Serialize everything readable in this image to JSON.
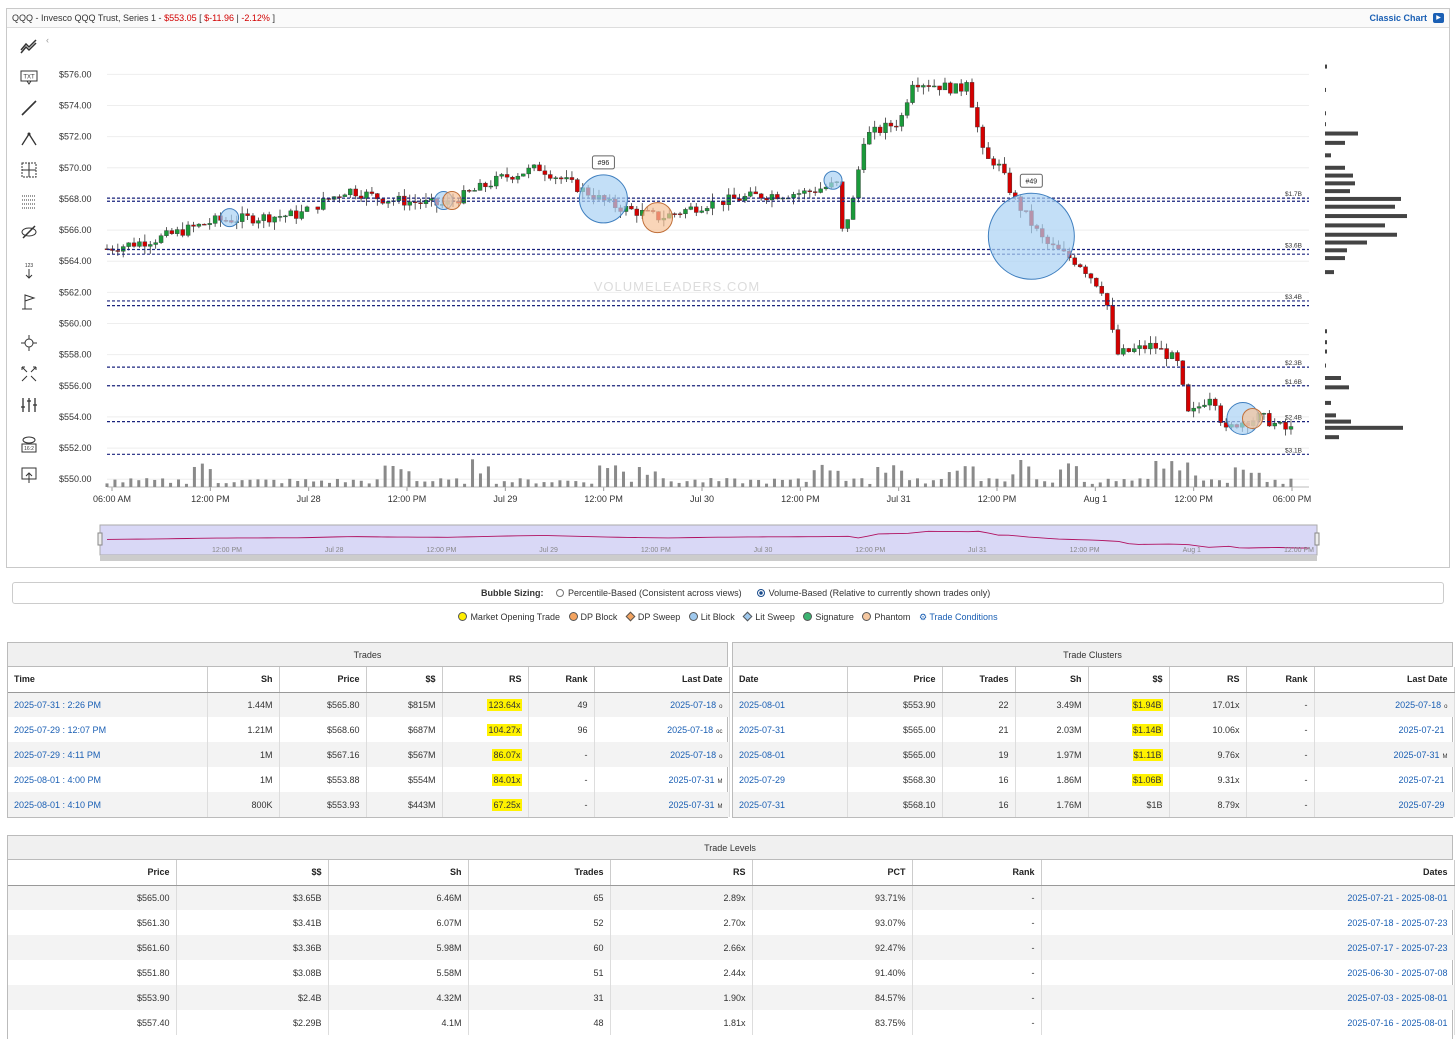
{
  "header": {
    "title": "QQQ - Invesco QQQ Trust, Series 1 -",
    "price": "$553.05",
    "bracket_open": "[",
    "change": "$-11.96",
    "separator": "|",
    "change_pct": "-2.12%",
    "bracket_close": "]",
    "classic_chart": "Classic Chart"
  },
  "toolbar": {
    "tools": [
      "trend-lines-icon",
      "text-icon",
      "line-icon",
      "pattern-icon",
      "crosshair-icon",
      "grid-icon",
      "hide-icon",
      "measure-icon",
      "flag-icon",
      "zoom-icon",
      "fullscreen-icon",
      "adjust-icon",
      "view-icon",
      "export-icon"
    ],
    "txt_label": "TXT",
    "num_label": "123",
    "view_label": "16:2"
  },
  "chart_data": {
    "type": "candlestick",
    "watermark": "VOLUMELEADERS.COM",
    "y_ticks": [
      "$576.00",
      "$574.00",
      "$572.00",
      "$570.00",
      "$568.00",
      "$566.00",
      "$564.00",
      "$562.00",
      "$560.00",
      "$558.00",
      "$556.00",
      "$554.00",
      "$552.00",
      "$550.00"
    ],
    "ylim": [
      549.5,
      577.5
    ],
    "x_ticks": [
      "06:00 AM",
      "12:00 PM",
      "Jul 28",
      "12:00 PM",
      "Jul 29",
      "12:00 PM",
      "Jul 30",
      "12:00 PM",
      "Jul 31",
      "12:00 PM",
      "Aug 1",
      "12:00 PM",
      "06:00 PM"
    ],
    "navigator_ticks": [
      "12:00 PM",
      "Jul 28",
      "12:00 PM",
      "Jul 29",
      "12:00 PM",
      "Jul 30",
      "12:00 PM",
      "Jul 31",
      "12:00 PM",
      "Aug 1",
      "12:00 PM"
    ],
    "levels": [
      {
        "price": 568.05,
        "label": "$1.7B"
      },
      {
        "price": 567.85,
        "label": ""
      },
      {
        "price": 564.75,
        "label": "$3.6B"
      },
      {
        "price": 564.45,
        "label": ""
      },
      {
        "price": 561.45,
        "label": "$3.4B"
      },
      {
        "price": 561.15,
        "label": ""
      },
      {
        "price": 557.2,
        "label": "$2.3B"
      },
      {
        "price": 556.0,
        "label": "$1.6B"
      },
      {
        "price": 553.7,
        "label": "$2.4B"
      },
      {
        "price": 551.6,
        "label": "$3.1B"
      }
    ],
    "bubbles": [
      {
        "t": 0.102,
        "price": 566.8,
        "size": 9,
        "kind": "lit"
      },
      {
        "t": 0.28,
        "price": 567.9,
        "size": 9,
        "kind": "lit"
      },
      {
        "t": 0.287,
        "price": 567.9,
        "size": 9,
        "kind": "phantom"
      },
      {
        "t": 0.413,
        "price": 568.0,
        "size": 24,
        "kind": "lit",
        "tag": "#96"
      },
      {
        "t": 0.458,
        "price": 566.8,
        "size": 15,
        "kind": "phantom"
      },
      {
        "t": 0.604,
        "price": 569.2,
        "size": 9,
        "kind": "lit"
      },
      {
        "t": 0.769,
        "price": 565.6,
        "size": 43,
        "kind": "lit",
        "tag": "#49"
      },
      {
        "t": 0.945,
        "price": 553.9,
        "size": 16,
        "kind": "lit"
      },
      {
        "t": 0.953,
        "price": 553.9,
        "size": 10,
        "kind": "phantom"
      }
    ],
    "profile_bars": [
      {
        "price": 576.5,
        "width": 2
      },
      {
        "price": 575,
        "width": 1
      },
      {
        "price": 573.5,
        "width": 1
      },
      {
        "price": 572.8,
        "width": 1
      },
      {
        "price": 572.2,
        "width": 33
      },
      {
        "price": 571.6,
        "width": 20
      },
      {
        "price": 570.8,
        "width": 6
      },
      {
        "price": 570.0,
        "width": 20
      },
      {
        "price": 569.5,
        "width": 28
      },
      {
        "price": 569.0,
        "width": 30
      },
      {
        "price": 568.5,
        "width": 25
      },
      {
        "price": 568.0,
        "width": 76
      },
      {
        "price": 567.5,
        "width": 70
      },
      {
        "price": 566.9,
        "width": 82
      },
      {
        "price": 566.3,
        "width": 60
      },
      {
        "price": 565.7,
        "width": 72
      },
      {
        "price": 565.2,
        "width": 42
      },
      {
        "price": 564.7,
        "width": 22
      },
      {
        "price": 564.2,
        "width": 20
      },
      {
        "price": 563.3,
        "width": 9
      },
      {
        "price": 559.5,
        "width": 2
      },
      {
        "price": 558.8,
        "width": 2
      },
      {
        "price": 558.2,
        "width": 2
      },
      {
        "price": 557.3,
        "width": 1
      },
      {
        "price": 556.5,
        "width": 16
      },
      {
        "price": 555.9,
        "width": 24
      },
      {
        "price": 554.9,
        "width": 6
      },
      {
        "price": 554.1,
        "width": 11
      },
      {
        "price": 553.7,
        "width": 26
      },
      {
        "price": 553.3,
        "width": 78
      },
      {
        "price": 552.7,
        "width": 14
      }
    ]
  },
  "bubble_sizing": {
    "label": "Bubble Sizing:",
    "option1": "Percentile-Based (Consistent across views)",
    "option2": "Volume-Based (Relative to currently shown trades only)"
  },
  "legend": {
    "items": [
      {
        "label": "Market Opening Trade",
        "color": "#ffee00",
        "shape": "dot"
      },
      {
        "label": "DP Block",
        "color": "#f4a460",
        "shape": "dot"
      },
      {
        "label": "DP Sweep",
        "color": "#f4a460",
        "shape": "diamond"
      },
      {
        "label": "Lit Block",
        "color": "#9fc9ee",
        "shape": "dot"
      },
      {
        "label": "Lit Sweep",
        "color": "#9fc9ee",
        "shape": "diamond"
      },
      {
        "label": "Signature",
        "color": "#3cb371",
        "shape": "dot"
      },
      {
        "label": "Phantom",
        "color": "#f4c7a0",
        "shape": "dot"
      }
    ],
    "conditions": "Trade Conditions"
  },
  "trades": {
    "title": "Trades",
    "columns": [
      "Time",
      "Sh",
      "Price",
      "$$",
      "RS",
      "Rank",
      "Last Date"
    ],
    "rows": [
      {
        "time": "2025-07-31 : 2:26 PM",
        "sh": "1.44M",
        "price": "$565.80",
        "dollars": "$815M",
        "rs": "123.64x",
        "rank": "49",
        "last": "2025-07-18",
        "sup": "o"
      },
      {
        "time": "2025-07-29 : 12:07 PM",
        "sh": "1.21M",
        "price": "$568.60",
        "dollars": "$687M",
        "rs": "104.27x",
        "rank": "96",
        "last": "2025-07-18",
        "sup": "oc"
      },
      {
        "time": "2025-07-29 : 4:11 PM",
        "sh": "1M",
        "price": "$567.16",
        "dollars": "$567M",
        "rs": "86.07x",
        "rank": "-",
        "last": "2025-07-18",
        "sup": "o"
      },
      {
        "time": "2025-08-01 : 4:00 PM",
        "sh": "1M",
        "price": "$553.88",
        "dollars": "$554M",
        "rs": "84.01x",
        "rank": "-",
        "last": "2025-07-31",
        "sup": "M"
      },
      {
        "time": "2025-08-01 : 4:10 PM",
        "sh": "800K",
        "price": "$553.93",
        "dollars": "$443M",
        "rs": "67.25x",
        "rank": "-",
        "last": "2025-07-31",
        "sup": "M"
      }
    ]
  },
  "clusters": {
    "title": "Trade Clusters",
    "columns": [
      "Date",
      "Price",
      "Trades",
      "Sh",
      "$$",
      "RS",
      "Rank",
      "Last Date"
    ],
    "rows": [
      {
        "date": "2025-08-01",
        "price": "$553.90",
        "trades": "22",
        "sh": "3.49M",
        "dollars": "$1.94B",
        "hl": true,
        "rs": "17.01x",
        "rank": "-",
        "last": "2025-07-18",
        "sup": "o"
      },
      {
        "date": "2025-07-31",
        "price": "$565.00",
        "trades": "21",
        "sh": "2.03M",
        "dollars": "$1.14B",
        "hl": true,
        "rs": "10.06x",
        "rank": "-",
        "last": "2025-07-21",
        "sup": ""
      },
      {
        "date": "2025-08-01",
        "price": "$565.00",
        "trades": "19",
        "sh": "1.97M",
        "dollars": "$1.11B",
        "hl": true,
        "rs": "9.76x",
        "rank": "-",
        "last": "2025-07-31",
        "sup": "M"
      },
      {
        "date": "2025-07-29",
        "price": "$568.30",
        "trades": "16",
        "sh": "1.86M",
        "dollars": "$1.06B",
        "hl": true,
        "rs": "9.31x",
        "rank": "-",
        "last": "2025-07-21",
        "sup": ""
      },
      {
        "date": "2025-07-31",
        "price": "$568.10",
        "trades": "16",
        "sh": "1.76M",
        "dollars": "$1B",
        "hl": false,
        "rs": "8.79x",
        "rank": "-",
        "last": "2025-07-29",
        "sup": ""
      }
    ]
  },
  "levels_table": {
    "title": "Trade Levels",
    "columns": [
      "Price",
      "$$",
      "Sh",
      "Trades",
      "RS",
      "PCT",
      "Rank",
      "Dates"
    ],
    "rows": [
      {
        "price": "$565.00",
        "dollars": "$3.65B",
        "sh": "6.46M",
        "trades": "65",
        "rs": "2.89x",
        "pct": "93.71%",
        "rank": "-",
        "dates": "2025-07-21 - 2025-08-01"
      },
      {
        "price": "$561.30",
        "dollars": "$3.41B",
        "sh": "6.07M",
        "trades": "52",
        "rs": "2.70x",
        "pct": "93.07%",
        "rank": "-",
        "dates": "2025-07-18 - 2025-07-23"
      },
      {
        "price": "$561.60",
        "dollars": "$3.36B",
        "sh": "5.98M",
        "trades": "60",
        "rs": "2.66x",
        "pct": "92.47%",
        "rank": "-",
        "dates": "2025-07-17 - 2025-07-23"
      },
      {
        "price": "$551.80",
        "dollars": "$3.08B",
        "sh": "5.58M",
        "trades": "51",
        "rs": "2.44x",
        "pct": "91.40%",
        "rank": "-",
        "dates": "2025-06-30 - 2025-07-08"
      },
      {
        "price": "$553.90",
        "dollars": "$2.4B",
        "sh": "4.32M",
        "trades": "31",
        "rs": "1.90x",
        "pct": "84.57%",
        "rank": "-",
        "dates": "2025-07-03 - 2025-08-01"
      },
      {
        "price": "$557.40",
        "dollars": "$2.29B",
        "sh": "4.1M",
        "trades": "48",
        "rs": "1.81x",
        "pct": "83.75%",
        "rank": "-",
        "dates": "2025-07-16 - 2025-08-01"
      }
    ]
  }
}
